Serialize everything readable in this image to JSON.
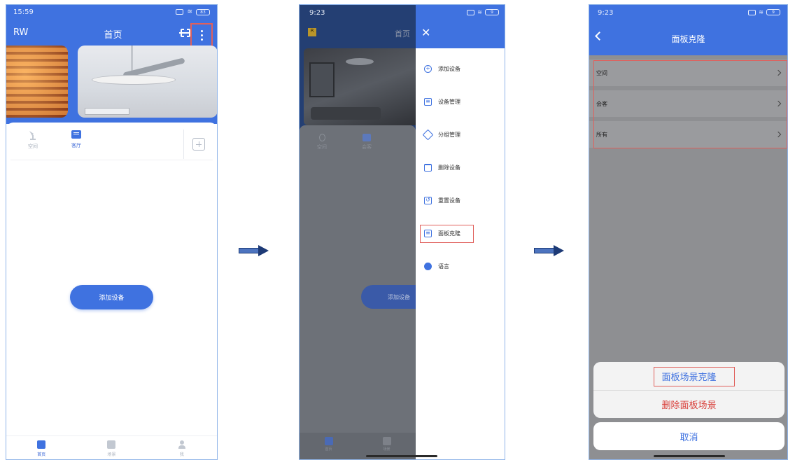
{
  "screen1": {
    "time": "15:59",
    "battery": "83",
    "brand": "RW",
    "title": "首页",
    "rooms": [
      {
        "label": "空间"
      },
      {
        "label": "客厅"
      }
    ],
    "add_device_label": "添加设备",
    "tabs": [
      {
        "label": "首页"
      },
      {
        "label": "场景"
      },
      {
        "label": "我"
      }
    ]
  },
  "screen2": {
    "time": "9:23",
    "battery": "9",
    "title_dim": "首页",
    "rooms": [
      {
        "label": "空间"
      },
      {
        "label": "会客"
      }
    ],
    "add_device_dim": "添加设备",
    "tabs": [
      {
        "label": "首页"
      },
      {
        "label": "场景"
      }
    ],
    "menu": [
      {
        "label": "添加设备",
        "icon": "add-circle-icon"
      },
      {
        "label": "设备管理",
        "icon": "device-list-icon"
      },
      {
        "label": "分组管理",
        "icon": "layers-icon"
      },
      {
        "label": "删除设备",
        "icon": "trash-icon"
      },
      {
        "label": "重置设备",
        "icon": "reset-icon"
      },
      {
        "label": "面板克隆",
        "icon": "panel-clone-icon"
      },
      {
        "label": "语言",
        "icon": "globe-icon"
      }
    ]
  },
  "screen3": {
    "time": "9:23",
    "battery": "9",
    "title": "面板克隆",
    "rows": [
      {
        "label": "空间"
      },
      {
        "label": "会客"
      },
      {
        "label": "所有"
      }
    ],
    "sheet": {
      "clone_label": "面板场景克隆",
      "delete_label": "删除面板场景",
      "cancel_label": "取消"
    }
  },
  "colors": {
    "primary": "#3f72e0",
    "highlight": "#e0605c",
    "danger": "#d9413c"
  }
}
